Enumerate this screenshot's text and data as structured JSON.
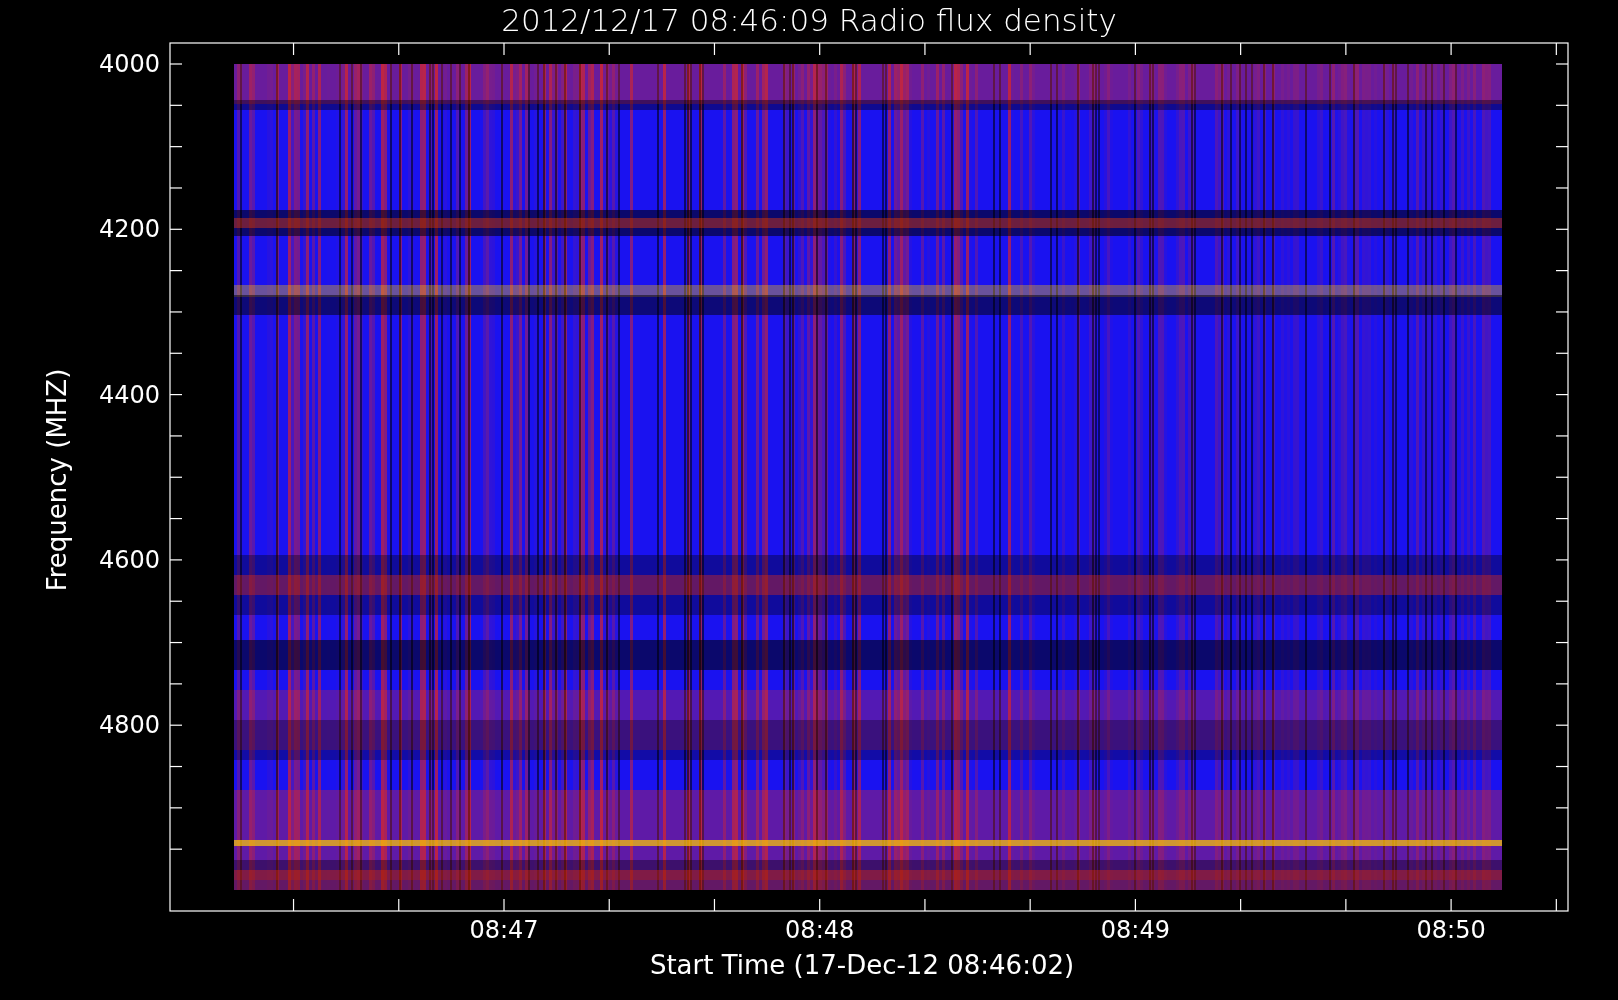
{
  "title": "2012/12/17 08:46:09 Radio flux density",
  "y_axis": {
    "label": "Frequency (MHZ)",
    "ticks": [
      "4000",
      "4200",
      "4400",
      "4600",
      "4800"
    ]
  },
  "x_axis": {
    "label": "Start Time (17-Dec-12 08:46:02)",
    "ticks": [
      "08:47",
      "08:48",
      "08:49",
      "08:50"
    ]
  }
}
